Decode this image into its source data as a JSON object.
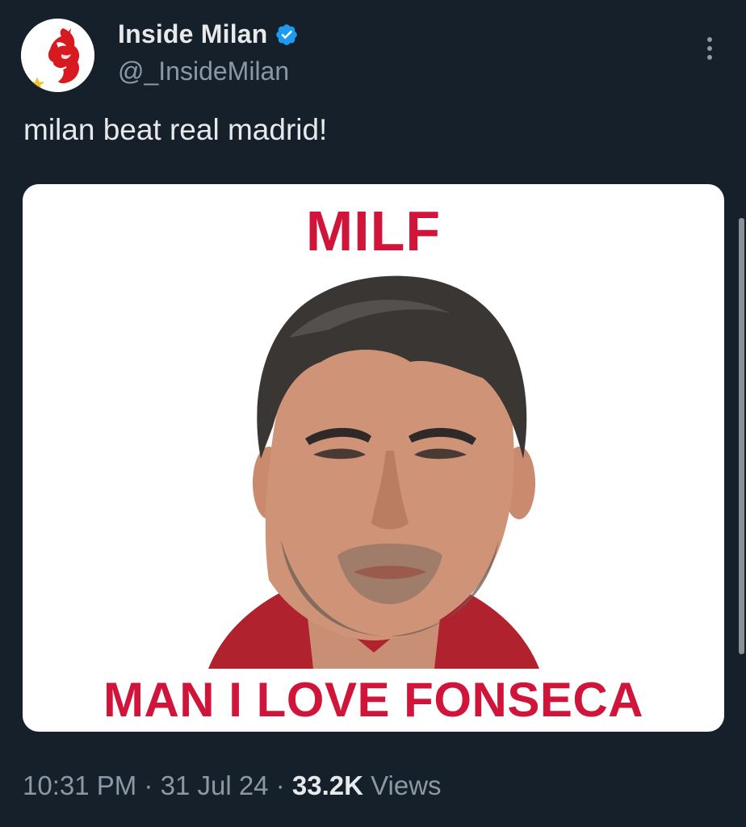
{
  "author": {
    "display_name": "Inside Milan",
    "handle": "@_InsideMilan",
    "verified": true,
    "avatar_icon": "milan-devil-logo-icon"
  },
  "tweet": {
    "text": "milan beat real madrid!"
  },
  "media": {
    "top_caption": "MILF",
    "bottom_caption": "MAN I LOVE FONSECA"
  },
  "meta": {
    "time": "10:31 PM",
    "separator": "·",
    "date": "31 Jul 24",
    "views_count": "33.2K",
    "views_label": "Views"
  },
  "colors": {
    "background": "#15202b",
    "primary_text": "#e7e9ea",
    "secondary_text": "#8b98a5",
    "verified_blue": "#1d9bf0",
    "meme_red": "#d0143a"
  }
}
